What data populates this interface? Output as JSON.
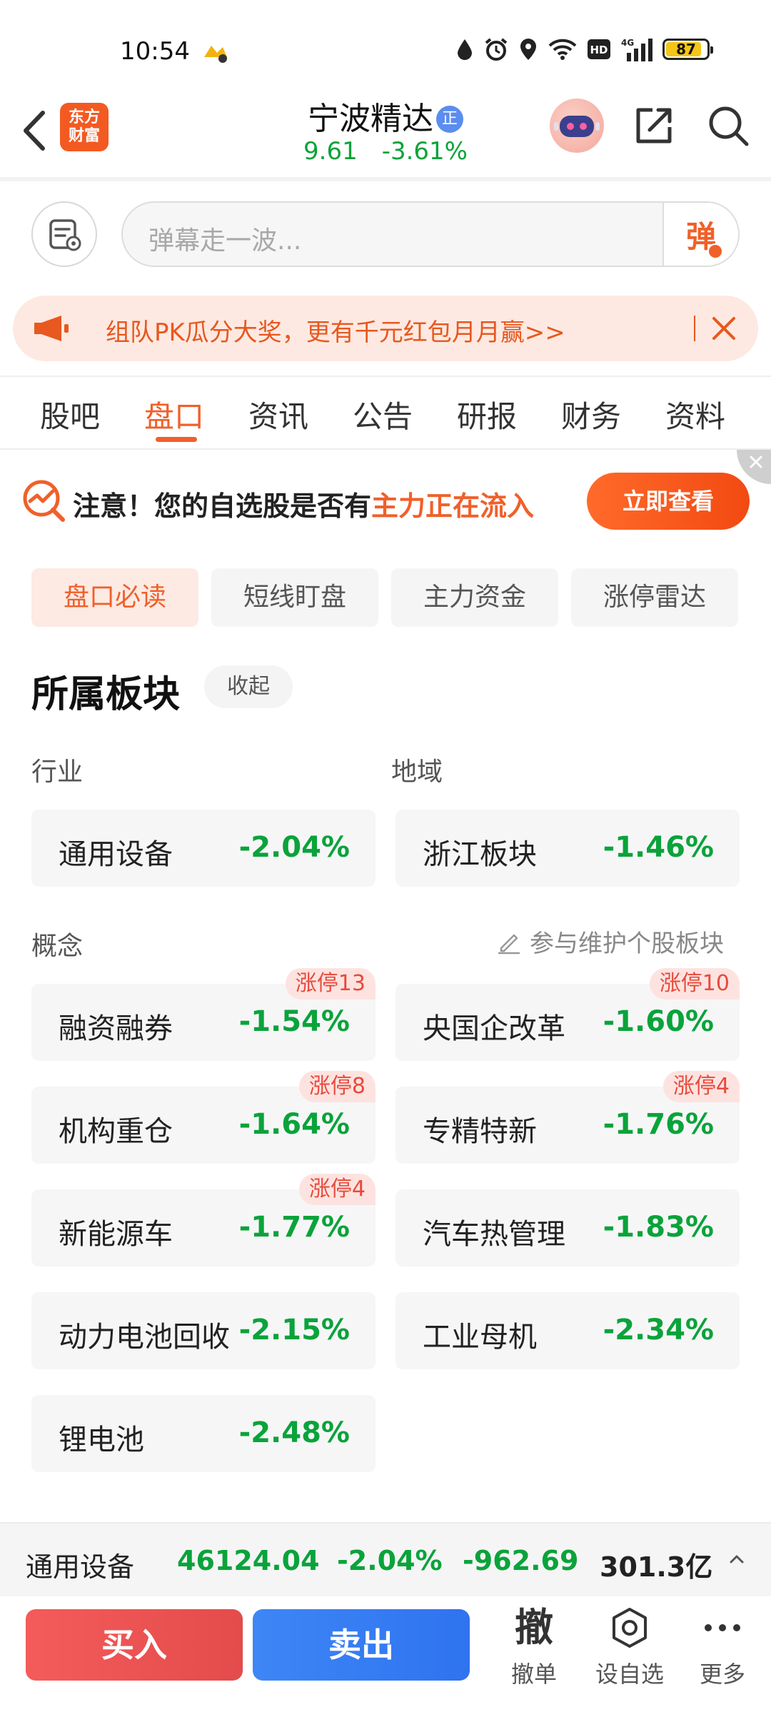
{
  "status_bar": {
    "time": "10:54",
    "battery": "87",
    "battery_level": 0.87,
    "network": "4G",
    "hd": "HD"
  },
  "header": {
    "logo_line1": "东方",
    "logo_line2": "财富",
    "stock_name": "宁波精达",
    "stock_badge": "正",
    "price": "9.61",
    "change_pct": "-3.61%"
  },
  "danmu": {
    "placeholder": "弹幕走一波...",
    "send_label": "弹"
  },
  "promo": {
    "text": "组队PK瓜分大奖，更有千元红包月月赢>>"
  },
  "tabs": [
    "股吧",
    "盘口",
    "资讯",
    "公告",
    "研报",
    "财务",
    "资料"
  ],
  "active_tab": "盘口",
  "notice": {
    "prefix": "注意！您的自选股是否有",
    "highlight": "主力正在流入",
    "button": "立即查看"
  },
  "subtabs": [
    "盘口必读",
    "短线盯盘",
    "主力资金",
    "涨停雷达"
  ],
  "section": {
    "title": "所属板块",
    "collapse": "收起",
    "industry_label": "行业",
    "region_label": "地域",
    "concept_label": "概念",
    "maintain_link": "参与维护个股板块"
  },
  "industry": {
    "name": "通用设备",
    "change": "-2.04%"
  },
  "region": {
    "name": "浙江板块",
    "change": "-1.46%"
  },
  "concepts": [
    {
      "name": "融资融券",
      "change": "-1.54%",
      "badge": "涨停13"
    },
    {
      "name": "央国企改革",
      "change": "-1.60%",
      "badge": "涨停10"
    },
    {
      "name": "机构重仓",
      "change": "-1.64%",
      "badge": "涨停8"
    },
    {
      "name": "专精特新",
      "change": "-1.76%",
      "badge": "涨停4"
    },
    {
      "name": "新能源车",
      "change": "-1.77%",
      "badge": "涨停4"
    },
    {
      "name": "汽车热管理",
      "change": "-1.83%",
      "badge": ""
    },
    {
      "name": "动力电池回收",
      "change": "-2.15%",
      "badge": ""
    },
    {
      "name": "工业母机",
      "change": "-2.34%",
      "badge": ""
    },
    {
      "name": "锂电池",
      "change": "-2.48%",
      "badge": ""
    }
  ],
  "ticker": {
    "name": "通用设备",
    "index": "46124.04",
    "change_pct": "-2.04%",
    "change": "-962.69",
    "turnover": "301.3亿"
  },
  "actions": {
    "buy": "买入",
    "sell": "卖出",
    "cancel_glyph": "撤",
    "cancel": "撤单",
    "watchlist": "设自选",
    "more": "更多"
  },
  "colors": {
    "accent": "#f0602a",
    "down_green": "#0aa33a",
    "buy_red": "#e44b4b",
    "sell_blue": "#2f73ef"
  }
}
